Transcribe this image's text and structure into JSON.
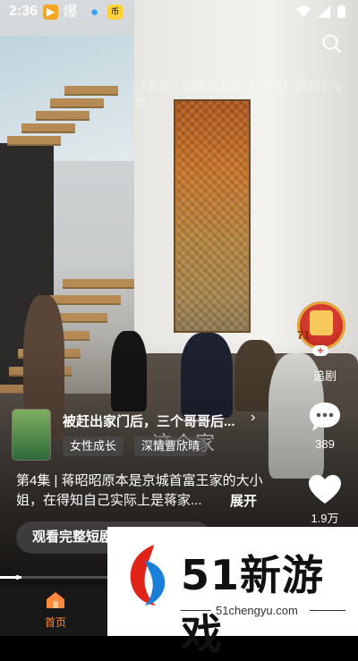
{
  "status_bar": {
    "time": "2:36",
    "app_icons": [
      "video-app-icon",
      "baozi-app-icon",
      "droplet-app-icon",
      "coin-app-icon"
    ],
    "status_icons": [
      "wifi-icon",
      "signal-icon",
      "battery-icon"
    ]
  },
  "player": {
    "watermark": "（备案）网微剧备字（2024）第23576号",
    "scene_caption": "这个家"
  },
  "side_actions": {
    "follow_count": "71",
    "follow_label": "追剧",
    "comment_count": "389",
    "like_count": "1.9万"
  },
  "drama_card": {
    "title": "被赶出家门后，三个哥哥后...",
    "tags": [
      "女性成长",
      "深情曹欣晴"
    ]
  },
  "description": {
    "text": "第4集 | 蒋昭昭原本是京城首富王家的大小姐，在得知自己实际上是蒋家...",
    "expand_label": "展开"
  },
  "watch_full_button": "观看完整短剧",
  "progress": 0.06,
  "bottom_nav": {
    "home_label": "首页"
  },
  "ad_overlay": {
    "brand": "51新游戏",
    "url": "51chengyu.com"
  },
  "colors": {
    "accent": "#ff8a3c",
    "nav_bg": "#181818"
  }
}
